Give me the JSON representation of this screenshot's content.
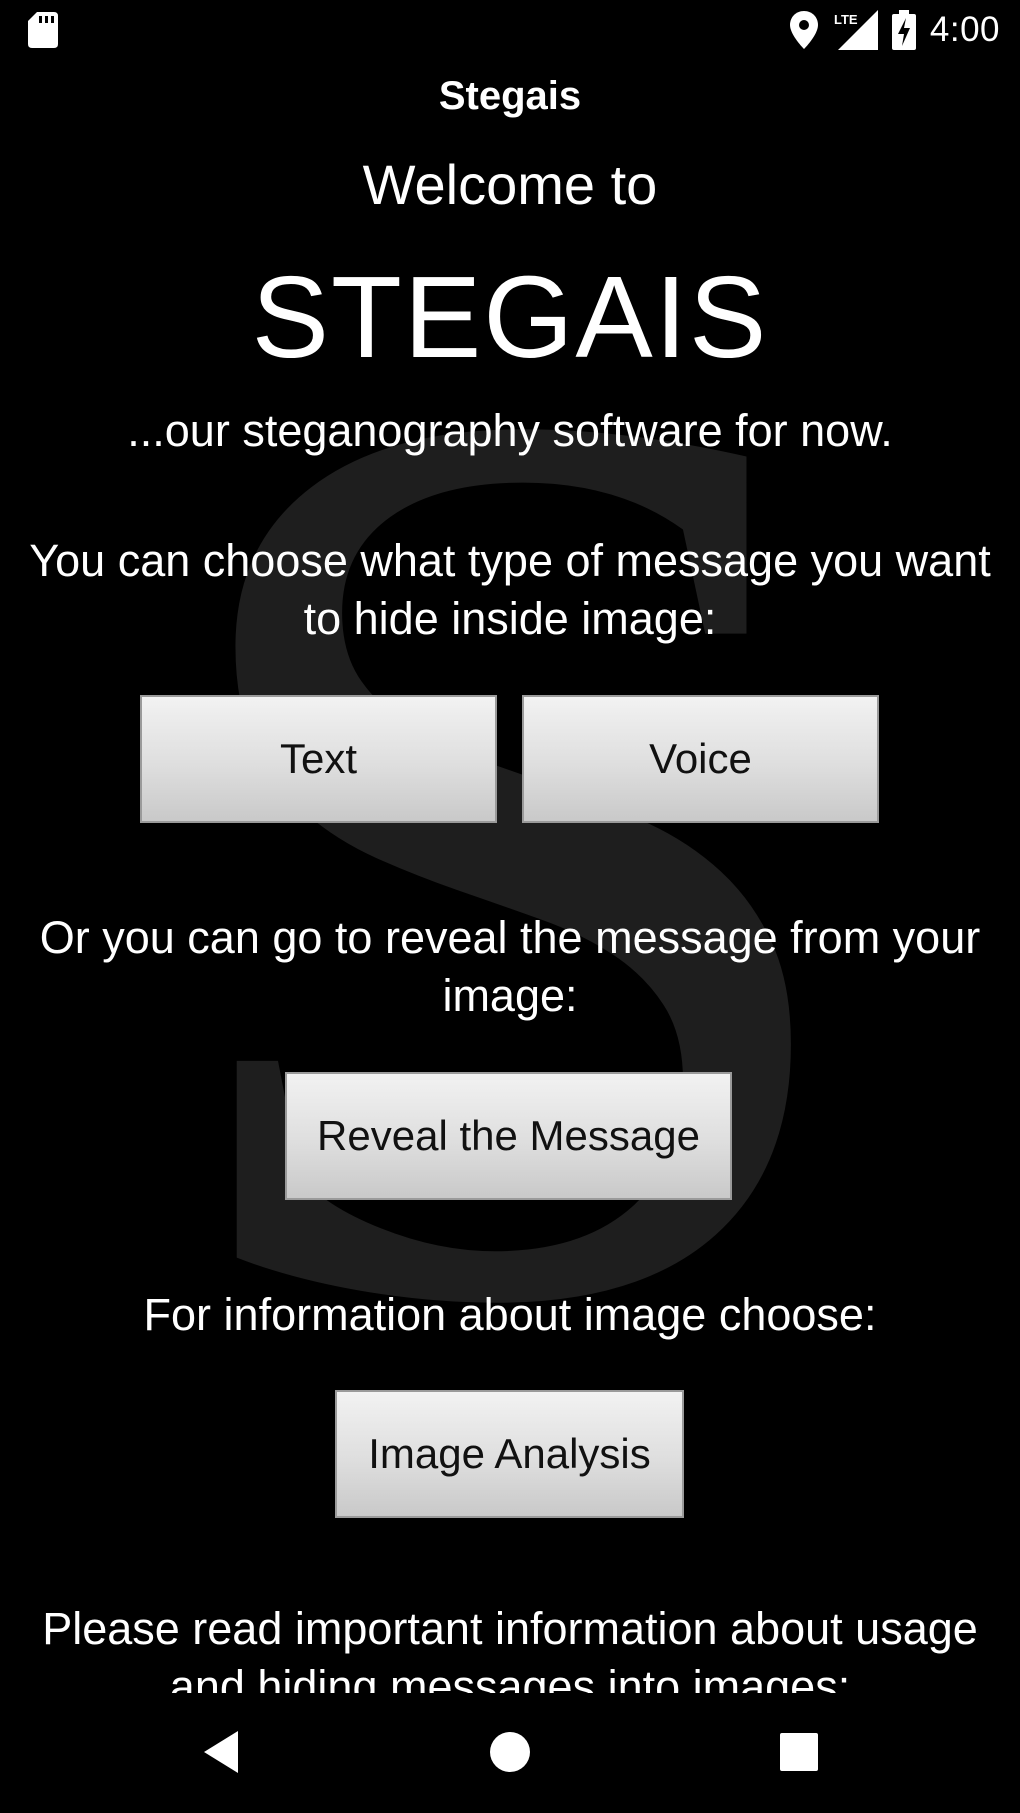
{
  "status_bar": {
    "time": "4:00",
    "network_label": "LTE",
    "icons": [
      "sd-card-icon",
      "location-icon",
      "signal-icon",
      "battery-charging-icon"
    ]
  },
  "app_bar": {
    "title": "Stegais"
  },
  "main": {
    "welcome": "Welcome to",
    "big_title": "STEGAIS",
    "tagline": "...our steganography software for now.",
    "choose_text": "You can choose what type of message you want to hide inside image:",
    "text_button": "Text",
    "voice_button": "Voice",
    "reveal_text": "Or you can go to reveal the message from your image:",
    "reveal_button": "Reveal the Message",
    "info_text": "For information about image choose:",
    "analysis_button": "Image Analysis",
    "important_text": "Please read important information about usage and hiding messages into images:"
  },
  "watermark": {
    "letter": "S"
  },
  "nav_bar": {
    "icons": [
      "back-icon",
      "home-icon",
      "recents-icon"
    ]
  },
  "colors": {
    "background": "#000000",
    "text": "#ffffff",
    "button_top": "#f2f2f2",
    "button_bottom": "#c9c9c9",
    "watermark": "#1e1e1e"
  }
}
